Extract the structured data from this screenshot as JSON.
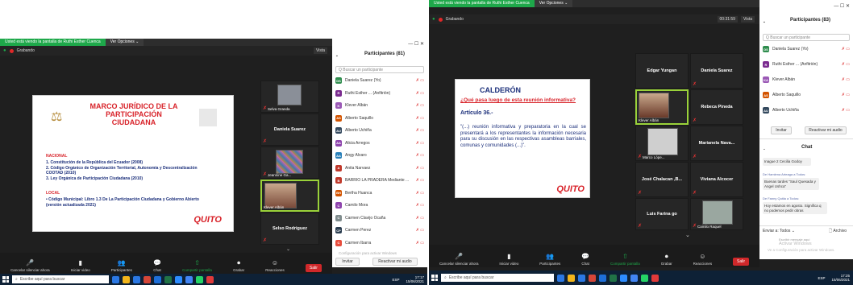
{
  "left": {
    "share_banner": "Usted está viendo la pantalla de Ruthi Esther Cuenca",
    "view_options": "Ver Opciones ⌄",
    "recording_label": "Grabando",
    "view_btn": "Vista",
    "slide": {
      "title": "MARCO JURÍDICO DE LA PARTICIPACIÓN CIUDADANA",
      "section1": "NACIONAL",
      "items1": [
        "1.  Constitución de la República del Ecuador (2008)",
        "2.  Código Orgánico de Organización Territorial, Autonomía y Descentralización COOTAD (2010)",
        "3.  Ley Orgánica de Participación Ciudadana (2010)"
      ],
      "section2": "LOCAL",
      "items2": [
        "•  Código Municipal: Libro 1.3 De La Participación Ciudadana y Gobierno Abierto (versión actualizada 2021)"
      ],
      "logo": "QUITO"
    },
    "tiles": [
      "Selva Granda",
      "Daniela Suarez",
      "Jeannine Ga...",
      "Klever Albán",
      "Selso Rodriguez"
    ],
    "panel_title": "Participantes (81)",
    "search_placeholder": "Q Buscar un participante",
    "participants": [
      {
        "initials": "DS",
        "name": "Daniela Suarez (Yo)",
        "color": "#2f8d4e"
      },
      {
        "initials": "R",
        "name": "Ruthi Esther ... (Anfitrión)",
        "color": "#7a2b8f"
      },
      {
        "initials": "K",
        "name": "Klever Albán",
        "color": "#9b59b6"
      },
      {
        "initials": "AS",
        "name": "Alberto Saquillo",
        "color": "#d35400"
      },
      {
        "initials": "AU",
        "name": "Alberto Uchiña",
        "color": "#34495e"
      },
      {
        "initials": "AA",
        "name": "Alicia Arregos",
        "color": "#8e44ad"
      },
      {
        "initials": "AA",
        "name": "Angy Alvaro",
        "color": "#2980b9"
      },
      {
        "initials": "A",
        "name": "Anita Narvaez",
        "color": "#c0392b"
      },
      {
        "initials": "B",
        "name": "BARRIO LA PRADERA Mediante ...",
        "color": "#c0392b"
      },
      {
        "initials": "BH",
        "name": "Bertha Huanca",
        "color": "#d35400"
      },
      {
        "initials": "C",
        "name": "Camilo Mora",
        "color": "#8e44ad"
      },
      {
        "initials": "C",
        "name": "Carmen Clavijo Ocaña",
        "color": "#7f8c8d"
      },
      {
        "initials": "CP",
        "name": "Carmen Perez",
        "color": "#2c3e50"
      },
      {
        "initials": "C",
        "name": "Carmen Ibarra",
        "color": "#e74c3c"
      }
    ],
    "invite": "Invitar",
    "mute_all": "Reactivar mi audio",
    "activate": "Configuración para activar Windows",
    "toolbar": [
      {
        "label": "Cancelar silenciar ahora",
        "icon": "🎤"
      },
      {
        "label": "Iniciar video",
        "icon": "▮"
      },
      {
        "label": "Participantes",
        "icon": "👥"
      },
      {
        "label": "Chat",
        "icon": "💬"
      },
      {
        "label": "Compartir pantalla",
        "icon": "⇧"
      },
      {
        "label": "Grabar",
        "icon": "⏺"
      },
      {
        "label": "Reacciones",
        "icon": "☺"
      }
    ],
    "leave": "Salir",
    "taskbar_search": "Escribe aquí para buscar",
    "clock_time": "17:17",
    "clock_date": "15/06/2021",
    "lang": "ESP"
  },
  "right": {
    "share_banner": "Usted está viendo la pantalla de Ruthi Esther Cuenca",
    "view_options": "Ver Opciones ⌄",
    "recording_label": "Grabando",
    "timer": "00:31:59",
    "view_btn": "Vista",
    "slide": {
      "brand": "CALDERÓN",
      "question": "¿Qué pasa luego de esta reunión informativa?",
      "article": "Artículo 36.-",
      "body": "\"(...) reunión informativa y preparatoria en la cual se presentará a los representantes la información necesaria para su discusión en las respectivas asambleas barriales, comunas y comunidades (...)\".",
      "logo": "QUITO"
    },
    "tiles": [
      "Edgar Yungan",
      "Daniela Suarez",
      "Klever Albán",
      "Rebeca Pineda",
      "Marco Lópe...",
      "Marianela Nava...",
      "José Chalacan ,B...",
      "Viviana Alcocer",
      "Luis Farina go",
      "Camilo Raquel"
    ],
    "panel_title": "Participantes (83)",
    "search_placeholder": "Q Buscar un participante",
    "participants": [
      {
        "initials": "DS",
        "name": "Daniela Suarez (Yo)",
        "color": "#2f8d4e"
      },
      {
        "initials": "R",
        "name": "Ruthi Esther ... (Anfitrión)",
        "color": "#7a2b8f"
      },
      {
        "initials": "KA",
        "name": "Klever Albán",
        "color": "#9b59b6"
      },
      {
        "initials": "AS",
        "name": "Alberto Saquillo",
        "color": "#d35400"
      },
      {
        "initials": "AU",
        "name": "Alberto Uchiña",
        "color": "#34495e"
      }
    ],
    "invite": "Invitar",
    "mute_all": "Reactivar mi audio",
    "chat_title": "Chat",
    "chat_msgs": [
      {
        "meta": "",
        "text": "Inague 2 Cecilia Godoy"
      },
      {
        "meta": "De Hamlena Arteaga a Todos:",
        "text": "Buenas tardes \"Saul Quesada y Angel Ushca\""
      },
      {
        "meta": "De Fanny Quitia a Todos:",
        "text": "Hoy estamos en agosto. Significa q no podemos pedir obras"
      }
    ],
    "send_to": "Enviar a:  Todos ⌄",
    "archive": "Archivo",
    "compose": "Escribir mensaje aquí",
    "activate": "Activar Windows",
    "activate2": "Ve a Configuración para activar Windows.",
    "toolbar": [
      {
        "label": "Cancelar silenciar ahora",
        "icon": "🎤"
      },
      {
        "label": "Iniciar video",
        "icon": "▮"
      },
      {
        "label": "Participantes",
        "icon": "👥"
      },
      {
        "label": "Chat",
        "icon": "💬"
      },
      {
        "label": "Compartir pantalla",
        "icon": "⇧"
      },
      {
        "label": "Grabar",
        "icon": "⏺"
      },
      {
        "label": "Reacciones",
        "icon": "☺"
      }
    ],
    "leave": "Salir",
    "taskbar_search": "Escribe aquí para buscar",
    "clock_time": "17:25",
    "clock_date": "15/06/2021",
    "lang": "ESP"
  },
  "colors": {
    "accent_red": "#d8232a",
    "navy": "#1a2e7a",
    "share_green": "#1ea84a",
    "leave_red": "#d0282a"
  }
}
